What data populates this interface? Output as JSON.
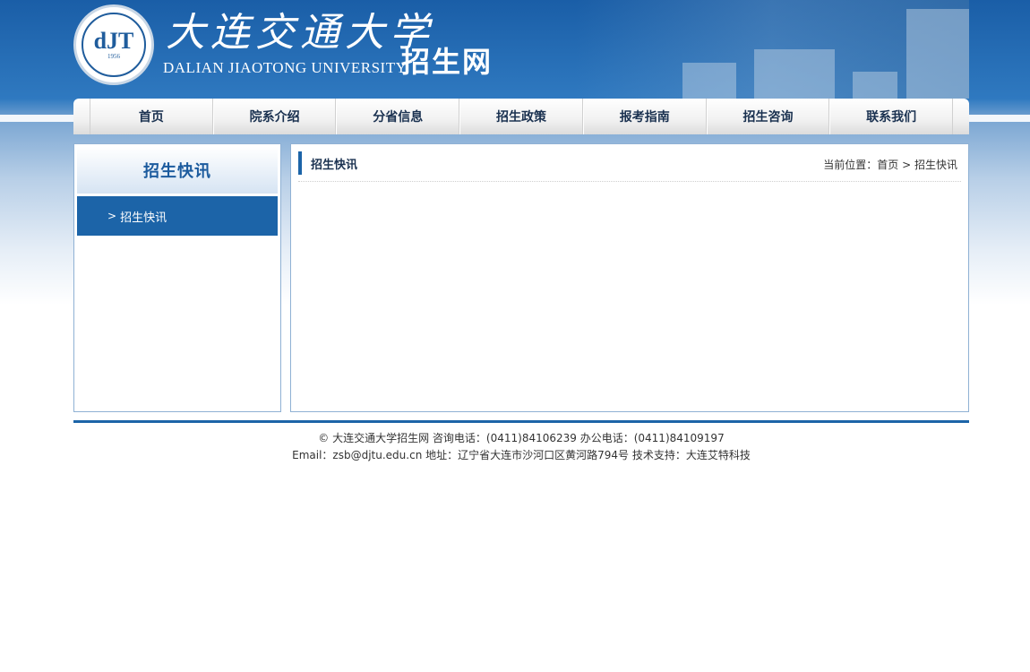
{
  "header": {
    "logo_monogram": "dJT",
    "logo_year": "1956",
    "university_cn": "大连交通大学",
    "university_en": "DALIAN JIAOTONG UNIVERSITY",
    "site_name": "招生网"
  },
  "nav": {
    "items": [
      {
        "label": "首页"
      },
      {
        "label": "院系介绍"
      },
      {
        "label": "分省信息"
      },
      {
        "label": "招生政策"
      },
      {
        "label": "报考指南"
      },
      {
        "label": "招生咨询"
      },
      {
        "label": "联系我们"
      }
    ]
  },
  "sidebar": {
    "title": "招生快讯",
    "items": [
      {
        "chevron": ">",
        "label": "招生快讯"
      }
    ]
  },
  "main": {
    "title": "招生快讯",
    "breadcrumb": {
      "prefix": "当前位置：",
      "home": "首页",
      "separator": ">",
      "current": "招生快讯"
    }
  },
  "footer": {
    "line1": "© 大连交通大学招生网 咨询电话：(0411)84106239 办公电话：(0411)84109197",
    "line2": "Email：zsb@djtu.edu.cn 地址：辽宁省大连市沙河口区黄河路794号 技术支持：大连艾特科技"
  },
  "colors": {
    "brand_blue": "#1c64a8",
    "nav_text": "#1a3150",
    "border": "#8fb1d4"
  }
}
